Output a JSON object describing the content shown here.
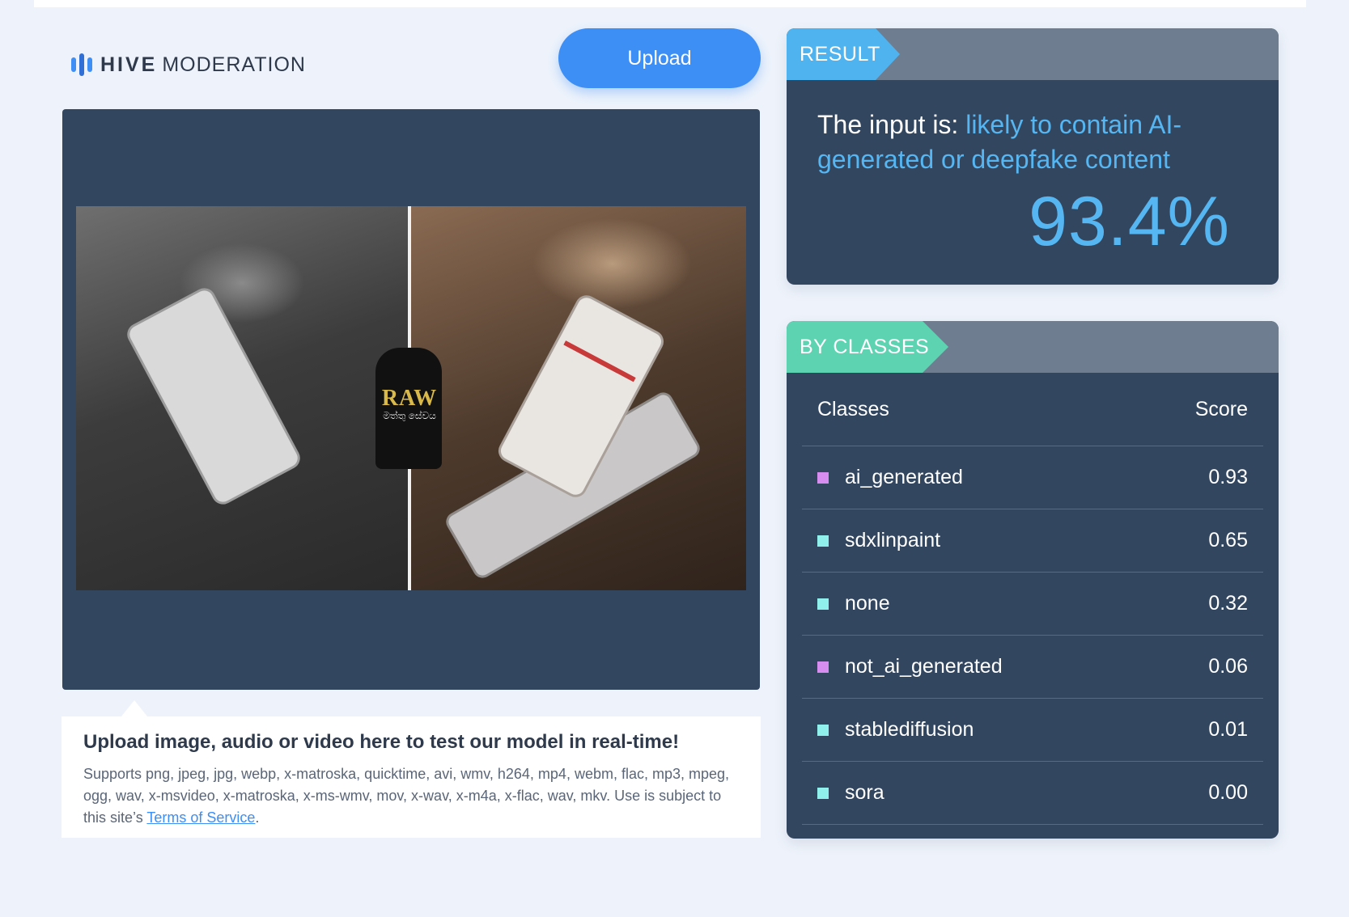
{
  "header": {
    "logo_bold": "HIVE",
    "logo_light": "MODERATION",
    "upload_label": "Upload"
  },
  "preview": {
    "watermark_text": "RAW",
    "watermark_sub": "මත්තු සේවය"
  },
  "info": {
    "title": "Upload image, audio or video here to test our model in real-time!",
    "description": "Supports png, jpeg, jpg, webp, x-matroska, quicktime, avi, wmv, h264, mp4, webm, flac, mp3, mpeg, ogg, wav, x-msvideo, x-matroska, x-ms-wmv, mov, x-wav, x-m4a, x-flac, wav, mkv. Use is subject to this site’s ",
    "terms_link": "Terms of Service",
    "terms_suffix": "."
  },
  "result": {
    "tag": "RESULT",
    "prefix": "The input is: ",
    "verdict": "likely to contain AI-generated or deepfake content",
    "score": "93.4%"
  },
  "classes": {
    "tag": "BY CLASSES",
    "col_class": "Classes",
    "col_score": "Score",
    "rows": [
      {
        "label": "ai_generated",
        "score": "0.93",
        "color": "#d78df0"
      },
      {
        "label": "sdxlinpaint",
        "score": "0.65",
        "color": "#8ff0ec"
      },
      {
        "label": "none",
        "score": "0.32",
        "color": "#8ff0ec"
      },
      {
        "label": "not_ai_generated",
        "score": "0.06",
        "color": "#d78df0"
      },
      {
        "label": "stablediffusion",
        "score": "0.01",
        "color": "#8ff0ec"
      },
      {
        "label": "sora",
        "score": "0.00",
        "color": "#8ff0ec"
      }
    ]
  },
  "colors": {
    "accent": "#3d8ef5",
    "panel": "#33465f",
    "result_blue": "#56b6f2",
    "classes_green": "#5dd3b2"
  }
}
